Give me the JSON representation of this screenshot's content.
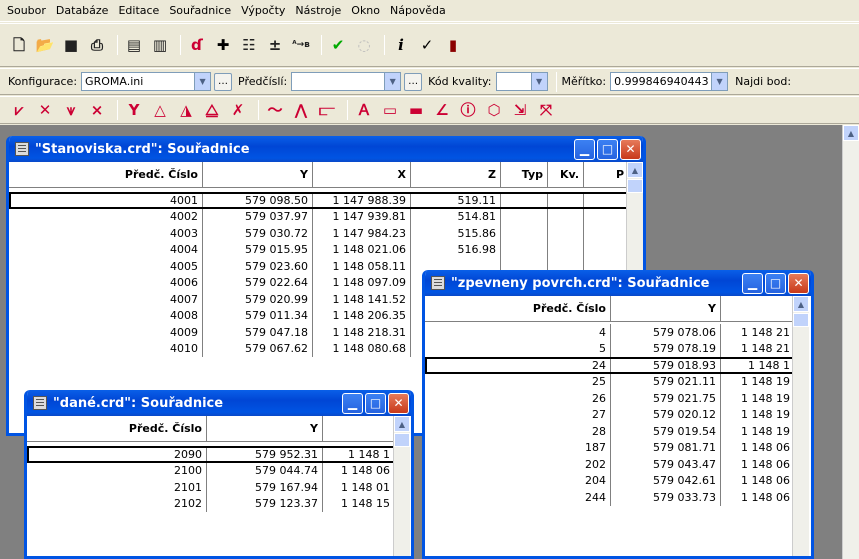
{
  "menu": [
    "Soubor",
    "Databáze",
    "Editace",
    "Souřadnice",
    "Výpočty",
    "Nástroje",
    "Okno",
    "Nápověda"
  ],
  "toolbar2": {
    "config_label": "Konfigurace:",
    "config_value": "GROMA.ini",
    "prefix_label": "Předčíslí:",
    "prefix_value": "",
    "quality_label": "Kód kvality:",
    "quality_value": "",
    "scale_label": "Měřítko:",
    "scale_value": "0.999846940443",
    "find_label": "Najdi bod:"
  },
  "win_stanoviska": {
    "title": "\"Stanoviska.crd\": Souřadnice",
    "headers": [
      "Předč. Číslo",
      "Y",
      "X",
      "Z",
      "Typ",
      "Kv.",
      "P"
    ],
    "rows": [
      [
        "4001",
        "579 098.50",
        "1 147 988.39",
        "519.11",
        "",
        "",
        ""
      ],
      [
        "4002",
        "579 037.97",
        "1 147 939.81",
        "514.81",
        "",
        "",
        ""
      ],
      [
        "4003",
        "579 030.72",
        "1 147 984.23",
        "515.86",
        "",
        "",
        ""
      ],
      [
        "4004",
        "579 015.95",
        "1 148 021.06",
        "516.98",
        "",
        "",
        ""
      ],
      [
        "4005",
        "579 023.60",
        "1 148 058.11",
        "",
        "",
        "",
        ""
      ],
      [
        "4006",
        "579 022.64",
        "1 148 097.09",
        "",
        "",
        "",
        ""
      ],
      [
        "4007",
        "579 020.99",
        "1 148 141.52",
        "",
        "",
        "",
        ""
      ],
      [
        "4008",
        "579 011.34",
        "1 148 206.35",
        "",
        "",
        "",
        ""
      ],
      [
        "4009",
        "579 047.18",
        "1 148 218.31",
        "",
        "",
        "",
        ""
      ],
      [
        "4010",
        "579 067.62",
        "1 148 080.68",
        "",
        "",
        "",
        ""
      ]
    ]
  },
  "win_dane": {
    "title": "\"dané.crd\": Souřadnice",
    "headers": [
      "Předč. Číslo",
      "Y",
      ""
    ],
    "rows": [
      [
        "2090",
        "579 952.31",
        "1 148 1"
      ],
      [
        "2100",
        "579 044.74",
        "1 148 06"
      ],
      [
        "2101",
        "579 167.94",
        "1 148 01"
      ],
      [
        "2102",
        "579 123.37",
        "1 148 15"
      ]
    ]
  },
  "win_zpevneny": {
    "title": "\"zpevneny povrch.crd\": Souřadnice",
    "headers": [
      "Předč. Číslo",
      "Y",
      ""
    ],
    "rows": [
      [
        "4",
        "579 078.06",
        "1 148 21"
      ],
      [
        "5",
        "579 078.19",
        "1 148 21"
      ],
      [
        "24",
        "579 018.93",
        "1 148 1"
      ],
      [
        "25",
        "579 021.11",
        "1 148 19"
      ],
      [
        "26",
        "579 021.75",
        "1 148 19"
      ],
      [
        "27",
        "579 020.12",
        "1 148 19"
      ],
      [
        "28",
        "579 019.54",
        "1 148 19"
      ],
      [
        "187",
        "579 081.71",
        "1 148 06"
      ],
      [
        "202",
        "579 043.47",
        "1 148 06"
      ],
      [
        "204",
        "579 042.61",
        "1 148 06"
      ],
      [
        "244",
        "579 033.73",
        "1 148 06"
      ]
    ]
  },
  "icons": {
    "toolbar1": [
      "new-file-icon",
      "open-folder-icon",
      "save-icon",
      "print-icon",
      "page-icon",
      "page-edit-icon",
      "pen-icon",
      "plus-icon",
      "stack-icon",
      "plus-minus-icon",
      "ab-icon",
      "check-chart-icon",
      "disabled-icon",
      "info-icon",
      "checkmark-icon",
      "book-icon"
    ],
    "toolbar3": [
      "draw-v1-icon",
      "draw-x1-icon",
      "draw-v2-icon",
      "draw-x2-icon",
      "fork-icon",
      "triangle1-icon",
      "triangle2-icon",
      "triangle3-icon",
      "cross-icon",
      "polyline-icon",
      "polyline2-icon",
      "step-icon",
      "line-a-icon",
      "rect-icon",
      "rect2-icon",
      "angle-icon",
      "help-icon",
      "cube-icon",
      "arrow-v-icon",
      "arrow-x-icon"
    ]
  },
  "colors": {
    "titlebar": "#0054e3",
    "close": "#c8391a",
    "desktop": "#808080",
    "chrome": "#ece9d8",
    "toolicon": "#cc0033"
  }
}
